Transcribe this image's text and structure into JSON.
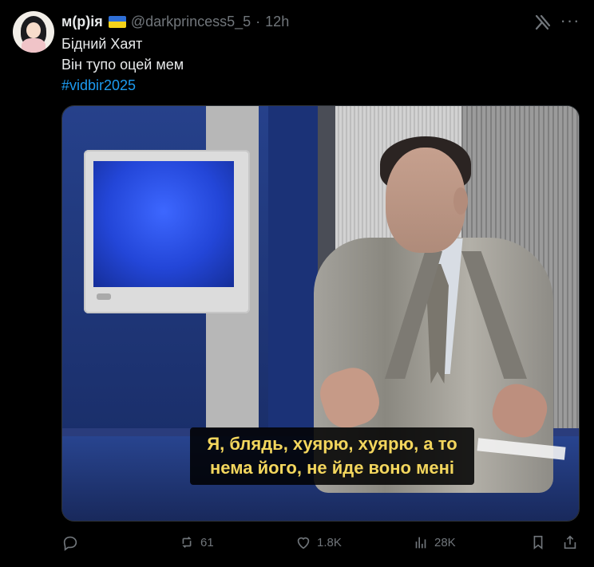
{
  "author": {
    "display_name": "м(р)ія",
    "handle": "@darkprincess5_5",
    "separator": "·",
    "time": "12h",
    "flag_icon": "ukraine-flag-icon",
    "avatar_icon": "anime-avatar-icon"
  },
  "tweet": {
    "lines": [
      "Бідний Хаят",
      "Він тупо оцей мем"
    ],
    "hashtag": "#vidbir2025"
  },
  "media": {
    "subtitle_line1": "Я, блядь, хуярю, хуярю, а то",
    "subtitle_line2": "нема його, не йде воно мені"
  },
  "actions": {
    "reply_icon": "reply-icon",
    "reply_count": "",
    "retweet_icon": "retweet-icon",
    "retweet_count": "61",
    "like_icon": "heart-icon",
    "like_count": "1.8K",
    "views_icon": "views-icon",
    "views_count": "28K",
    "bookmark_icon": "bookmark-icon",
    "share_icon": "share-icon"
  },
  "top_icons": {
    "grok_icon": "grok-icon",
    "more_icon": "more-icon"
  }
}
